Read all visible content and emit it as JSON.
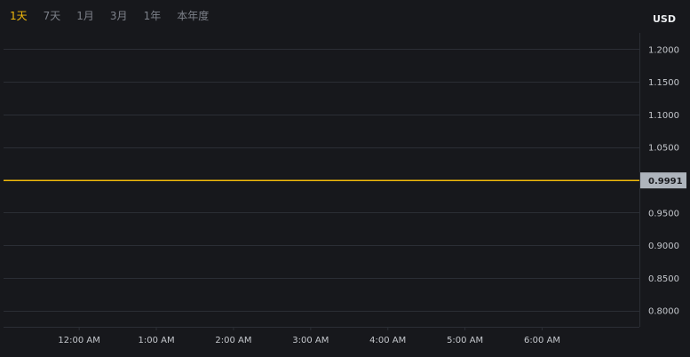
{
  "tabs": [
    {
      "label": "1天",
      "active": true
    },
    {
      "label": "7天",
      "active": false
    },
    {
      "label": "1月",
      "active": false
    },
    {
      "label": "3月",
      "active": false
    },
    {
      "label": "1年",
      "active": false
    },
    {
      "label": "本年度",
      "active": false
    }
  ],
  "currency": "USD",
  "colors": {
    "background": "#17181c",
    "grid": "#2b2e35",
    "line": "#f0b90b",
    "active_tab": "#f0b90b",
    "inactive_tab": "#7c8089",
    "axis_text": "#c4c7cc",
    "price_label_bg": "#aeb4bc"
  },
  "chart_data": {
    "type": "line",
    "ylim": [
      0.775,
      1.225
    ],
    "y_ticks": [
      "1.2000",
      "1.1500",
      "1.1000",
      "1.0500",
      "0.9500",
      "0.9000",
      "0.8500",
      "0.8000"
    ],
    "y_tick_values": [
      1.2,
      1.15,
      1.1,
      1.05,
      0.95,
      0.9,
      0.85,
      0.8
    ],
    "x_ticks": [
      "12:00 AM",
      "1:00 AM",
      "2:00 AM",
      "3:00 AM",
      "4:00 AM",
      "5:00 AM",
      "6:00 AM"
    ],
    "x_range_hours": [
      -0.98,
      7.26
    ],
    "x_tick_hours": [
      0,
      1,
      2,
      3,
      4,
      5,
      6
    ],
    "series": [
      {
        "x_hours": [
          -0.98,
          0,
          1,
          2,
          3,
          4,
          5,
          6,
          7.26
        ],
        "values": [
          0.9991,
          0.9991,
          0.9991,
          0.9991,
          0.9991,
          0.9991,
          0.9991,
          0.9991,
          0.9991
        ]
      }
    ],
    "current_price": 0.9991,
    "current_price_label": "0.9991",
    "grid": true
  }
}
